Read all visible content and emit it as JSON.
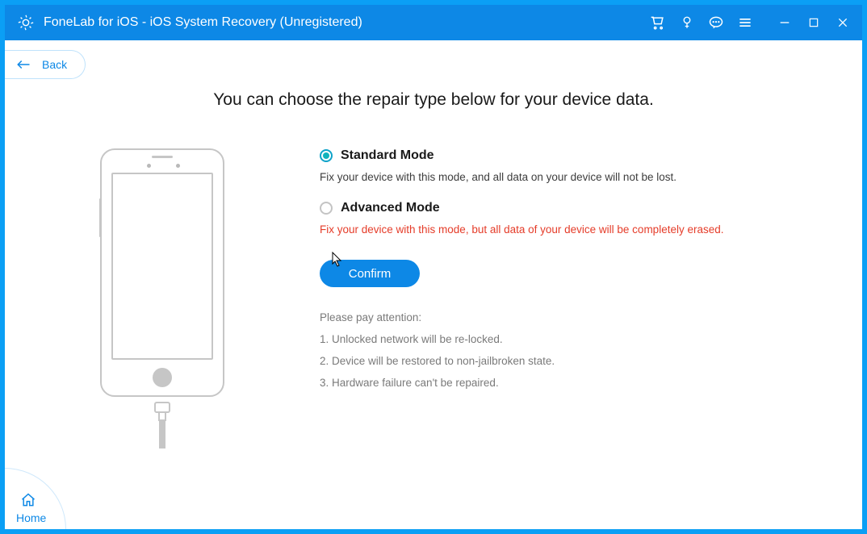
{
  "titlebar": {
    "title": "FoneLab for iOS - iOS System Recovery (Unregistered)"
  },
  "back": {
    "label": "Back"
  },
  "heading": "You can choose the repair type below for your device data.",
  "options": {
    "standard": {
      "title": "Standard Mode",
      "desc": "Fix your device with this mode, and all data on your device will not be lost.",
      "selected": true
    },
    "advanced": {
      "title": "Advanced Mode",
      "desc": "Fix your device with this mode, but all data of your device will be completely erased.",
      "selected": false
    }
  },
  "confirm": {
    "label": "Confirm"
  },
  "attention": {
    "head": "Please pay attention:",
    "lines": [
      "1. Unlocked network will be re-locked.",
      "2. Device will be restored to non-jailbroken state.",
      "3. Hardware failure can't be repaired."
    ]
  },
  "home": {
    "label": "Home"
  }
}
